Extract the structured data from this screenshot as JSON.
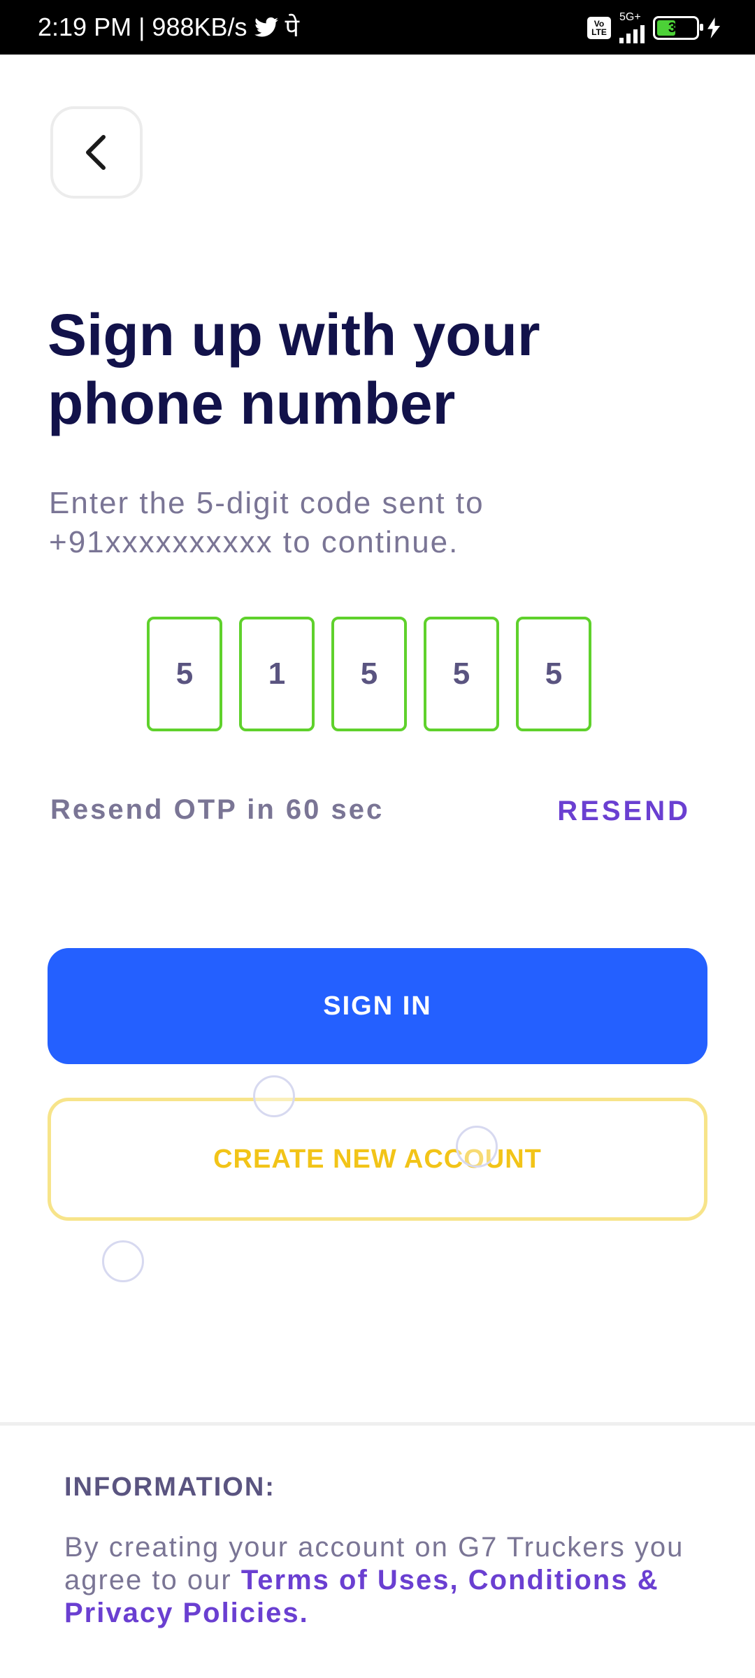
{
  "status_bar": {
    "time_speed": "2:19 PM | 988KB/s",
    "extra_glyph": "पे",
    "network": "5G+",
    "battery": "31"
  },
  "header": {
    "title": "Sign up with your phone number",
    "subtitle": "Enter the 5-digit code sent to +91xxxxxxxxxx to continue."
  },
  "otp": {
    "digits": [
      "5",
      "1",
      "5",
      "5",
      "5"
    ]
  },
  "resend": {
    "timer_text": "Resend OTP in 60 sec",
    "link_label": "RESEND"
  },
  "buttons": {
    "sign_in": "SIGN IN",
    "create_account": "CREATE NEW ACCOUNT"
  },
  "info": {
    "heading": "INFORMATION:",
    "text": "By creating your account on G7 Truckers you agree to our ",
    "link": "Terms of Uses, Conditions & Privacy Policies."
  },
  "colors": {
    "title": "#12124a",
    "primary_button": "#2460ff",
    "secondary_button_border": "#f7e48a",
    "secondary_button_text": "#f2c418",
    "otp_border": "#5fd12c",
    "link": "#6a3fd1"
  },
  "icons": [
    "back-chevron-icon",
    "twitter-icon",
    "volte-icon",
    "signal-icon",
    "battery-icon",
    "charging-icon"
  ]
}
